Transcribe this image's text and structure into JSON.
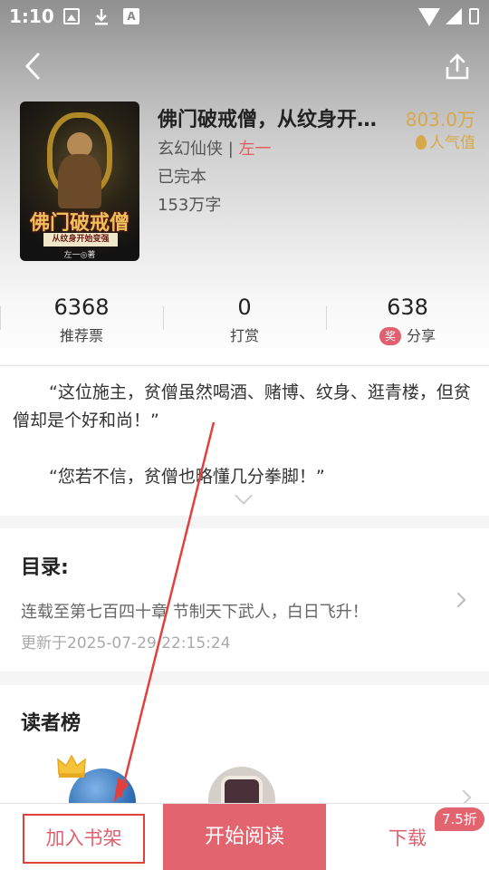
{
  "status_bar": {
    "time": "1:10",
    "icon_a": "A"
  },
  "nav": {
    "back_icon": "chevron-left-icon",
    "share_icon": "share-icon"
  },
  "book": {
    "cover": {
      "title": "佛门破戒僧",
      "subtitle": "从纹身开始变强",
      "author": "左一◎著"
    },
    "title": "佛门破戒僧，从纹身开始变强",
    "genre": "玄幻仙侠",
    "separator": " | ",
    "author": "左一",
    "status": "已完本",
    "word_count": "153万字",
    "popularity_value": "803.0万",
    "popularity_label": "人气值"
  },
  "stats": [
    {
      "value": "6368",
      "label": "推荐票"
    },
    {
      "value": "0",
      "label": "打赏"
    },
    {
      "value": "638",
      "label": "分享",
      "badge": "奖"
    }
  ],
  "intro": {
    "para1": "“这位施主，贫僧虽然喝酒、赌博、纹身、逛青楼，但贫僧却是个好和尚！”",
    "para2": "“您若不信，贫僧也略懂几分拳脚！”"
  },
  "toc": {
    "heading": "目录:",
    "latest_chapter": "连载至第七百四十章 节制天下武人，白日飞升！",
    "updated": "更新于2025-07-29 22:15:24"
  },
  "readers": {
    "heading": "读者榜"
  },
  "bottom": {
    "add_shelf": "加入书架",
    "start_read": "开始阅读",
    "download": "下载",
    "discount": "7.5折"
  },
  "colors": {
    "accent": "#e2646f",
    "gold": "#d7a84a",
    "annotation": "#e0413f"
  }
}
